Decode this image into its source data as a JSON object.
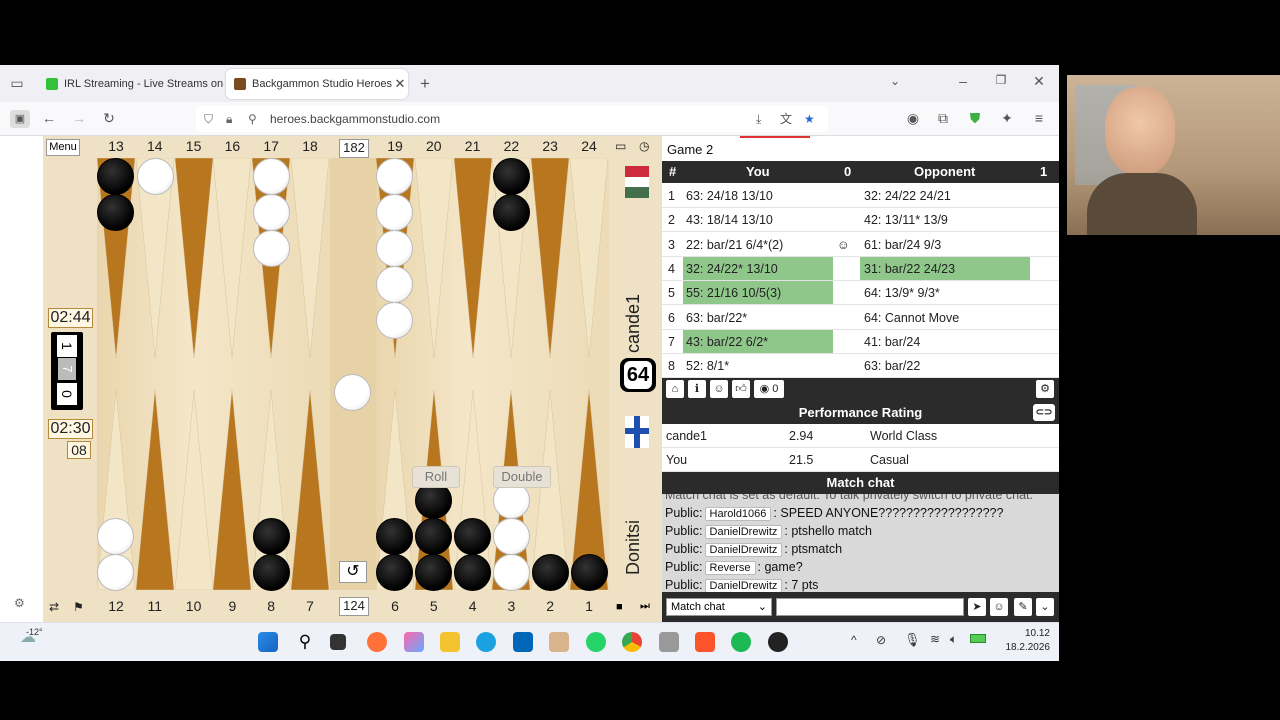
{
  "browser": {
    "tabs": [
      {
        "label": "IRL Streaming - Live Streams on",
        "active": false
      },
      {
        "label": "Backgammon Studio Heroes",
        "active": true
      }
    ],
    "url": "heroes.backgammonstudio.com"
  },
  "board": {
    "menu_label": "Menu",
    "top_numbers": [
      "13",
      "14",
      "15",
      "16",
      "17",
      "18",
      "182",
      "19",
      "20",
      "21",
      "22",
      "23",
      "24"
    ],
    "bottom_numbers": [
      "12",
      "11",
      "10",
      "9",
      "8",
      "7",
      "124",
      "6",
      "5",
      "4",
      "3",
      "2",
      "1"
    ],
    "clock_top": "02:44",
    "clock_bottom": "02:30",
    "score_one": "1",
    "score_seven": "7",
    "score_zero": "0",
    "small_num": "08",
    "cube": "64",
    "roll_label": "Roll",
    "double_label": "Double",
    "opponent_name": "cande1",
    "player_name": "Donitsi",
    "undo": "↺"
  },
  "moves": {
    "game_label": "Game 2",
    "headers": {
      "num": "#",
      "you": "You",
      "you_score": "0",
      "opp": "Opponent",
      "opp_score": "1"
    },
    "rows": [
      {
        "n": "1",
        "you": "63: 24/18 13/10",
        "opp": "32: 24/22 24/21",
        "you_hl": false,
        "opp_hl": false,
        "mid": ""
      },
      {
        "n": "2",
        "you": "43: 18/14 13/10",
        "opp": "42: 13/11* 13/9",
        "you_hl": false,
        "opp_hl": false,
        "mid": ""
      },
      {
        "n": "3",
        "you": "22: bar/21 6/4*(2)",
        "opp": "61: bar/24 9/3",
        "you_hl": false,
        "opp_hl": false,
        "mid": "☺"
      },
      {
        "n": "4",
        "you": "32: 24/22* 13/10",
        "opp": "31: bar/22 24/23",
        "you_hl": true,
        "opp_hl": true,
        "mid": ""
      },
      {
        "n": "5",
        "you": "55: 21/16 10/5(3)",
        "opp": "64: 13/9* 9/3*",
        "you_hl": true,
        "opp_hl": false,
        "mid": ""
      },
      {
        "n": "6",
        "you": "63: bar/22*",
        "opp": "64: Cannot Move",
        "you_hl": false,
        "opp_hl": false,
        "mid": ""
      },
      {
        "n": "7",
        "you": "43: bar/22 6/2*",
        "opp": "41: bar/24",
        "you_hl": true,
        "opp_hl": false,
        "mid": ""
      },
      {
        "n": "8",
        "you": "52: 8/1*",
        "opp": "63: bar/22",
        "you_hl": false,
        "opp_hl": false,
        "mid": ""
      }
    ]
  },
  "toolbar": {
    "views": "0"
  },
  "perf": {
    "title": "Performance Rating",
    "rows": [
      {
        "name": "cande1",
        "value": "2.94",
        "rating": "World Class"
      },
      {
        "name": "You",
        "value": "21.5",
        "rating": "Casual"
      }
    ]
  },
  "chat": {
    "title": "Match chat",
    "notice": "Match chat is set as default. To talk privately switch to private chat.",
    "lines": [
      {
        "prefix": "Public:",
        "user": "Harold1066",
        "text": ": SPEED ANYONE??????????????????"
      },
      {
        "prefix": "Public:",
        "user": "DanielDrewitz",
        "text": ": ptshello match"
      },
      {
        "prefix": "Public:",
        "user": "DanielDrewitz",
        "text": ": ptsmatch"
      },
      {
        "prefix": "Public:",
        "user": "Reverse",
        "text": ": game?"
      },
      {
        "prefix": "Public:",
        "user": "DanielDrewitz",
        "text": ": 7 pts"
      }
    ],
    "select_value": "Match chat"
  },
  "taskbar": {
    "weather": "-12°",
    "time": "10.12",
    "date": "18.2.2026"
  },
  "colors": {
    "highlight": "#8fc78a",
    "dark_point": "#b8761f",
    "light_point": "#f3e6c7"
  }
}
